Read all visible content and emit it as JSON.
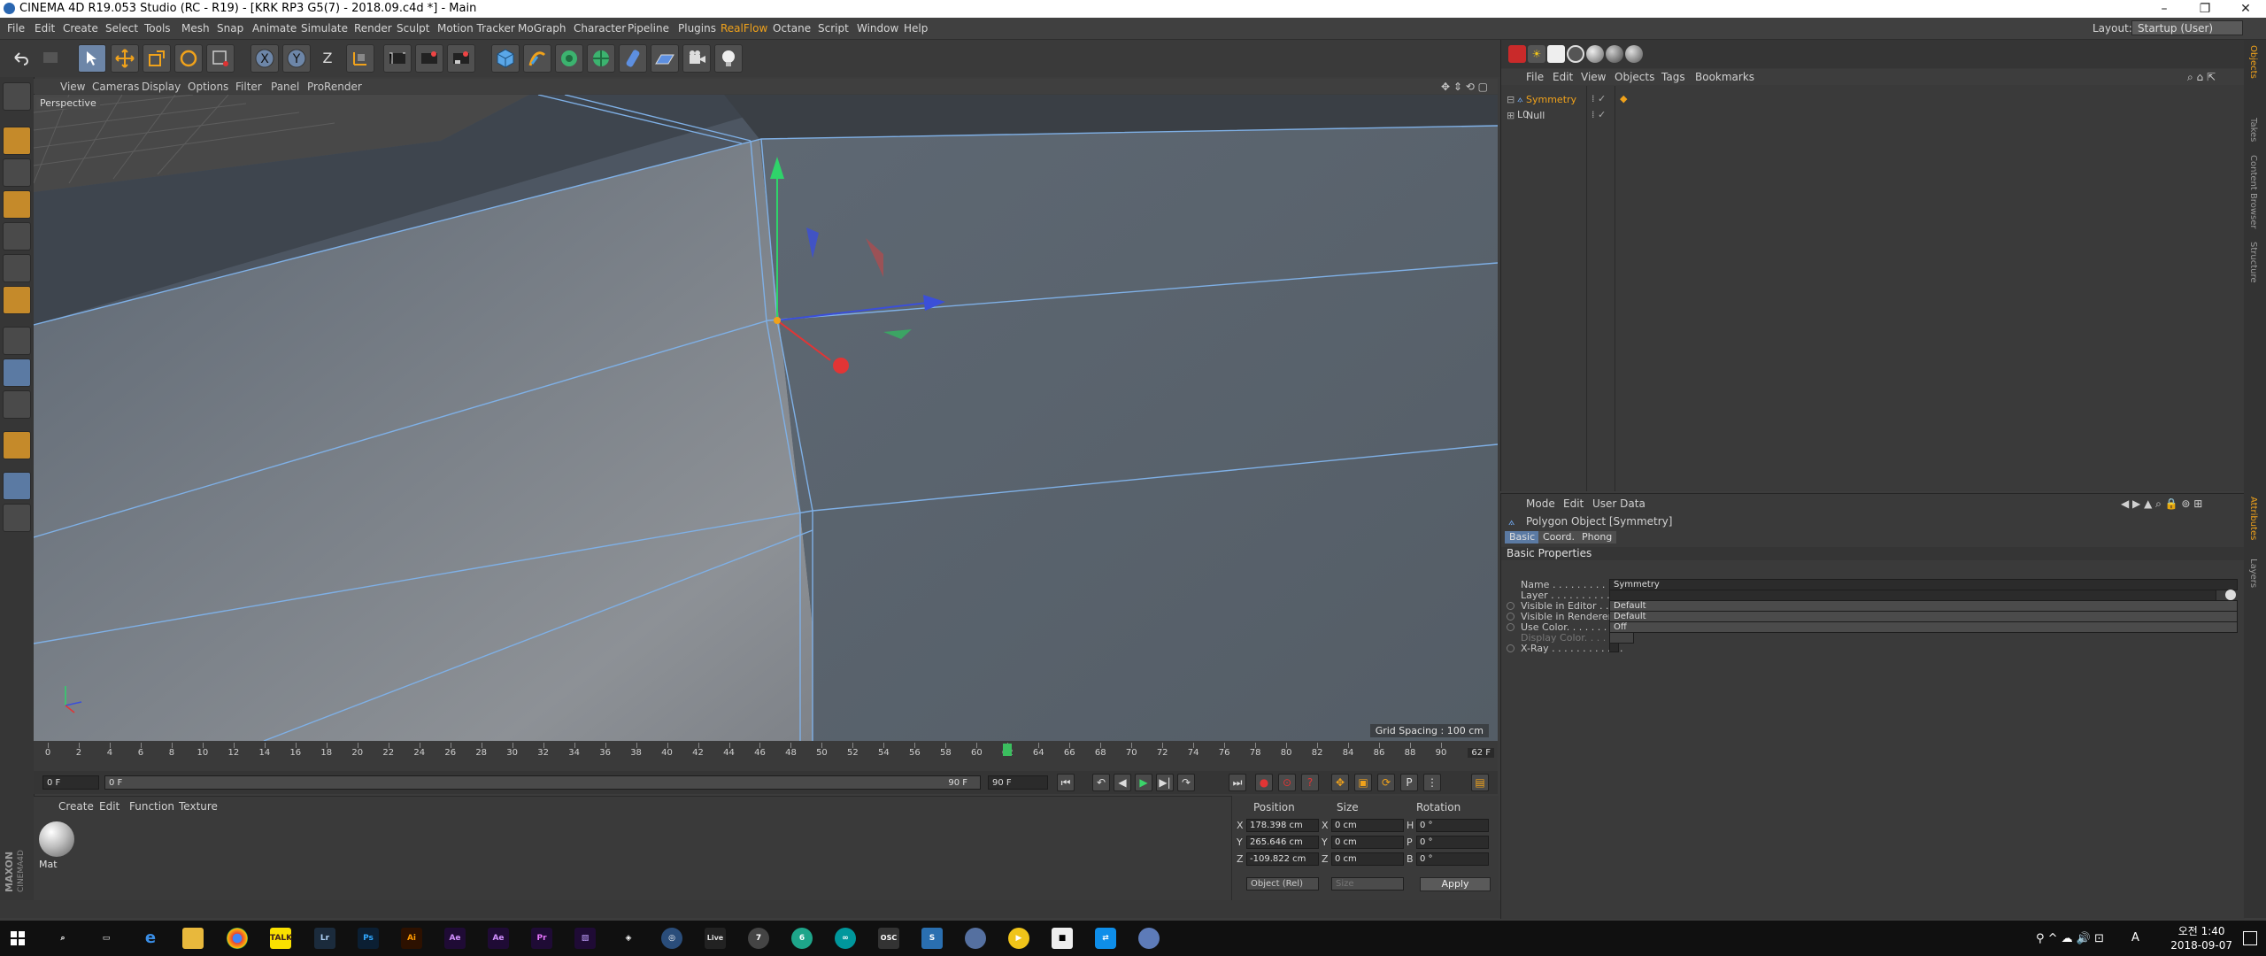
{
  "window": {
    "title": "CINEMA 4D R19.053 Studio (RC - R19) - [KRK RP3 G5(7) - 2018.09.c4d *] - Main",
    "minimize": "–",
    "maximize": "❐",
    "close": "✕"
  },
  "menubar": {
    "items": [
      "File",
      "Edit",
      "Create",
      "Select",
      "Tools",
      "Mesh",
      "Snap",
      "Animate",
      "Simulate",
      "Render",
      "Sculpt",
      "Motion Tracker",
      "MoGraph",
      "Character",
      "Pipeline",
      "Plugins",
      "RealFlow",
      "Octane",
      "Script",
      "Window",
      "Help"
    ],
    "accent_item": "RealFlow",
    "layout_label": "Layout:",
    "layout_value": "Startup (User)"
  },
  "toolbar": {
    "icons": [
      "undo-icon",
      "redo-icon",
      "live-selection-icon",
      "move-icon",
      "scale-icon",
      "rotate-icon",
      "recent-tool-icon",
      "x-axis-lock-icon",
      "y-axis-lock-icon",
      "z-axis-lock-icon",
      "coordinate-system-icon",
      "render-view-icon",
      "render-picture-viewer-icon",
      "edit-render-settings-icon",
      "cube-icon",
      "pen-icon",
      "subdivision-icon",
      "cloner-icon",
      "deformer-icon",
      "floor-icon",
      "camera-icon",
      "light-icon"
    ],
    "axis_x": "X",
    "axis_y": "Y",
    "axis_z": "Z"
  },
  "viewport": {
    "menu": [
      "View",
      "Cameras",
      "Display",
      "Options",
      "Filter",
      "Panel",
      "ProRender"
    ],
    "camera_label": "Perspective",
    "grid_spacing": "Grid Spacing : 100 cm"
  },
  "timeline": {
    "ticks": [
      "0",
      "2",
      "4",
      "6",
      "8",
      "10",
      "12",
      "14",
      "16",
      "18",
      "20",
      "22",
      "24",
      "26",
      "28",
      "30",
      "32",
      "34",
      "36",
      "38",
      "40",
      "42",
      "44",
      "46",
      "48",
      "50",
      "52",
      "54",
      "56",
      "58",
      "60",
      "62",
      "64",
      "66",
      "68",
      "70",
      "72",
      "74",
      "76",
      "78",
      "80",
      "82",
      "84",
      "86",
      "88",
      "90"
    ],
    "current_frame": 62,
    "current_frame_label": "62 F",
    "max_frame": 90
  },
  "transport": {
    "start_field": "0 F",
    "range_start": "0 F",
    "range_end": "90 F",
    "end_field": "90 F"
  },
  "material_manager": {
    "menu": [
      "Create",
      "Edit",
      "Function",
      "Texture"
    ],
    "material_name": "Mat"
  },
  "coordinate_manager": {
    "headers": [
      "Position",
      "Size",
      "Rotation"
    ],
    "rows": [
      {
        "axis": "X",
        "position": "178.398 cm",
        "size_axis": "X",
        "size": "0 cm",
        "rot_axis": "H",
        "rotation": "0 °"
      },
      {
        "axis": "Y",
        "position": "265.646 cm",
        "size_axis": "Y",
        "size": "0 cm",
        "rot_axis": "P",
        "rotation": "0 °"
      },
      {
        "axis": "Z",
        "position": "-109.822 cm",
        "size_axis": "Z",
        "size": "0 cm",
        "rot_axis": "B",
        "rotation": "0 °"
      }
    ],
    "mode_select": "Object (Rel)",
    "size_select": "Size",
    "apply_label": "Apply"
  },
  "object_manager": {
    "menu": [
      "File",
      "Edit",
      "View",
      "Objects",
      "Tags",
      "Bookmarks"
    ],
    "objects": [
      {
        "name": "Symmetry",
        "selected": true
      },
      {
        "name": "Null",
        "selected": false
      }
    ]
  },
  "attribute_manager": {
    "menu": [
      "Mode",
      "Edit",
      "User Data"
    ],
    "object_title": "Polygon Object [Symmetry]",
    "tabs": [
      "Basic",
      "Coord.",
      "Phong"
    ],
    "section": "Basic Properties",
    "properties": [
      {
        "label": "Name . . . . . . . . . . . . . .",
        "value": "Symmetry",
        "type": "text"
      },
      {
        "label": "Layer . . . . . . . . . . . . . .",
        "value": "",
        "type": "text"
      },
      {
        "label": "Visible in Editor . . .",
        "value": "Default",
        "type": "dropdown"
      },
      {
        "label": "Visible in Renderer",
        "value": "Default",
        "type": "dropdown"
      },
      {
        "label": "Use Color. . . . . . . . .",
        "value": "Off",
        "type": "dropdown"
      },
      {
        "label": "Display Color. . . . . .",
        "value": "",
        "type": "color"
      },
      {
        "label": "X-Ray . . . . . . . . . . . .",
        "value": "",
        "type": "checkbox"
      }
    ]
  },
  "side_tabs": [
    "Objects",
    "Takes",
    "Content Browser",
    "Structure",
    "Attributes",
    "Layers"
  ],
  "taskbar": {
    "apps": [
      "search-icon",
      "task-view-icon",
      "edge-icon",
      "file-explorer-icon",
      "chrome-icon",
      "kakaotalk-icon",
      "lightroom-icon",
      "photoshop-icon",
      "illustrator-icon",
      "after-effects-icon",
      "after-effects-2-icon",
      "premiere-icon",
      "media-encoder-icon",
      "unity-icon",
      "cinema4d-icon",
      "ableton-live-icon",
      "app-7-icon",
      "app-6-icon",
      "arduino-icon",
      "osc-icon",
      "app-s-icon",
      "app-blue-icon",
      "app-yellow-icon",
      "app-black-icon",
      "teamviewer-icon",
      "app-last-icon"
    ],
    "labels": {
      "lightroom": "Lr",
      "photoshop": "Ps",
      "illustrator": "Ai",
      "after_effects": "Ae",
      "premiere": "Pr",
      "live": "Live",
      "osc": "OSC",
      "seven": "7",
      "six": "6"
    },
    "ime": "A",
    "time": "오전 1:40",
    "date": "2018-09-07"
  }
}
